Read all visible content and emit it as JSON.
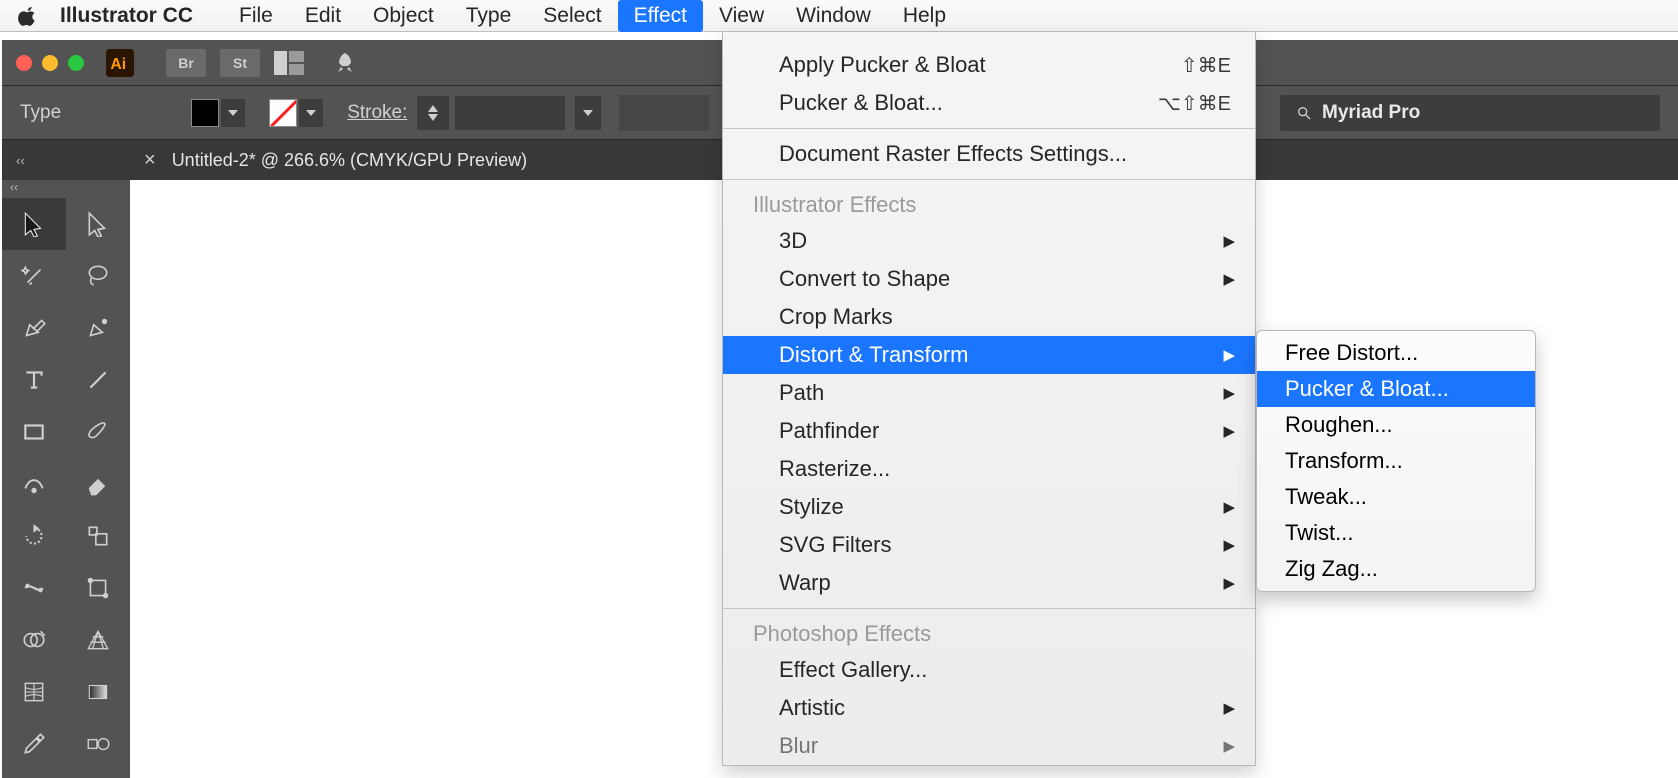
{
  "menubar": {
    "app_name": "Illustrator CC",
    "items": [
      "File",
      "Edit",
      "Object",
      "Type",
      "Select",
      "Effect",
      "View",
      "Window",
      "Help"
    ],
    "active_index": 5
  },
  "titlebar": {
    "chips": [
      "Br",
      "St"
    ]
  },
  "options": {
    "type_label": "Type",
    "stroke_label": "Stroke:",
    "font_name": "Myriad Pro"
  },
  "document_tab": {
    "title": "Untitled-2* @ 266.6% (CMYK/GPU Preview)"
  },
  "effect_menu": {
    "apply_last": "Apply Pucker & Bloat",
    "apply_last_shortcut": "⇧⌘E",
    "last_options": "Pucker & Bloat...",
    "last_options_shortcut": "⌥⇧⌘E",
    "raster_settings": "Document Raster Effects Settings...",
    "section1": "Illustrator Effects",
    "items1": [
      "3D",
      "Convert to Shape",
      "Crop Marks",
      "Distort & Transform",
      "Path",
      "Pathfinder",
      "Rasterize...",
      "Stylize",
      "SVG Filters",
      "Warp"
    ],
    "items1_sub": [
      true,
      true,
      false,
      true,
      true,
      true,
      false,
      true,
      true,
      true
    ],
    "hl_index": 3,
    "section2": "Photoshop Effects",
    "items2": [
      "Effect Gallery...",
      "Artistic",
      "Blur"
    ],
    "items2_sub": [
      false,
      true,
      true
    ]
  },
  "submenu": {
    "items": [
      "Free Distort...",
      "Pucker & Bloat...",
      "Roughen...",
      "Transform...",
      "Tweak...",
      "Twist...",
      "Zig Zag..."
    ],
    "hl_index": 1
  }
}
